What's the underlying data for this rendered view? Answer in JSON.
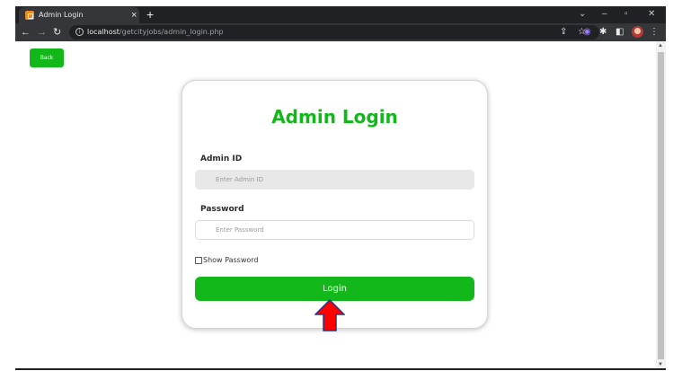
{
  "browser": {
    "tab_title": "Admin Login",
    "tab_close": "×",
    "new_tab": "+",
    "url_host": "localhost",
    "url_path": "/getcityjobs/admin_login.php",
    "icons": [
      "back-arrow-icon",
      "forward-arrow-icon",
      "reload-icon",
      "info-icon",
      "share-icon",
      "star-icon",
      "extension-icon",
      "puzzle-icon",
      "sidebar-icon",
      "avatar",
      "menu-icon"
    ]
  },
  "page": {
    "back_label": "Back",
    "title": "Admin Login",
    "admin_id_label": "Admin ID",
    "admin_id_placeholder": "Enter Admin ID",
    "password_label": "Password",
    "password_placeholder": "Enter Password",
    "show_password_label": "Show Password",
    "login_label": "Login"
  },
  "colors": {
    "accent": "#12b81a",
    "arrow_fill": "#ff0000",
    "arrow_stroke": "#1f3a93",
    "chrome_dark": "#202124",
    "chrome_mid": "#35363a"
  }
}
